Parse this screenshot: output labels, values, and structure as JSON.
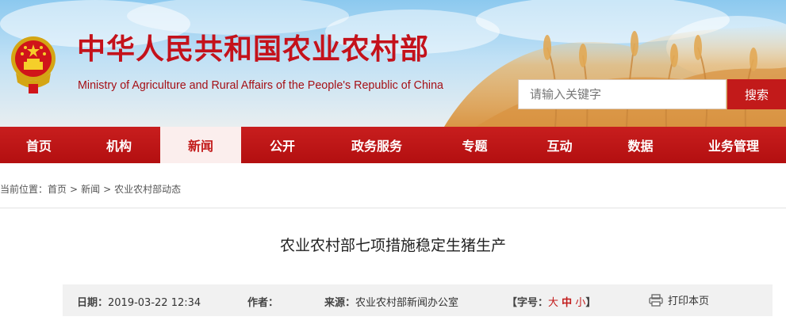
{
  "header": {
    "title_cn": "中华人民共和国农业农村部",
    "title_en": "Ministry of Agriculture and Rural Affairs of the People's Republic of China",
    "search_placeholder": "请输入关键字",
    "search_button": "搜索"
  },
  "nav": {
    "items": [
      {
        "label": "首页"
      },
      {
        "label": "机构"
      },
      {
        "label": "新闻"
      },
      {
        "label": "公开"
      },
      {
        "label": "政务服务"
      },
      {
        "label": "专题"
      },
      {
        "label": "互动"
      },
      {
        "label": "数据"
      },
      {
        "label": "业务管理"
      }
    ],
    "active_index": 2
  },
  "breadcrumb": {
    "prefix": "当前位置：",
    "items": [
      "首页",
      "新闻",
      "农业农村部动态"
    ],
    "separator": ">"
  },
  "article": {
    "title": "农业农村部七项措施稳定生猪生产",
    "date_label": "日期：",
    "date": "2019-03-22 12:34",
    "author_label": "作者：",
    "author": "",
    "source_label": "来源：",
    "source": "农业农村部新闻办公室",
    "font_label": "【字号：",
    "font_sizes": [
      "大",
      "中",
      "小"
    ],
    "font_close": "】",
    "print_label": "打印本页"
  },
  "colors": {
    "brand_red": "#c4121b",
    "nav_red": "#b30f10",
    "active_tab_bg": "#fbeeed"
  },
  "icons": {
    "emblem": "national-emblem",
    "print": "printer-icon"
  }
}
